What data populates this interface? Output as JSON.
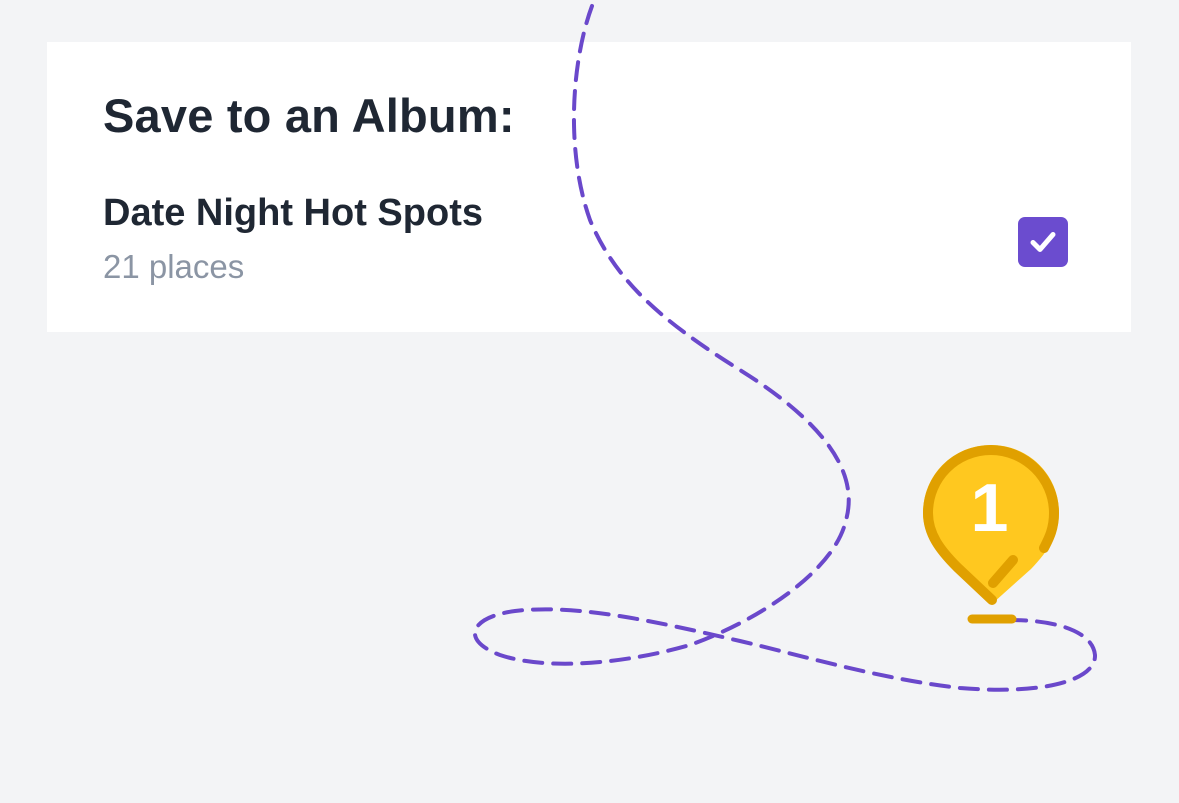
{
  "dialog": {
    "title": "Save to an Album:"
  },
  "album": {
    "name": "Date Night Hot Spots",
    "count": "21 places",
    "checked": true
  },
  "illustration": {
    "pin_number": "1",
    "path_style": "dashed",
    "icon": "map-pin-icon"
  },
  "colors": {
    "background": "#f3f4f6",
    "card": "#ffffff",
    "title": "#1f2733",
    "subtext": "#8b95a4",
    "accent": "#6b4ccf",
    "pin_fill": "#ffc81f",
    "pin_outline": "#e0a000"
  }
}
